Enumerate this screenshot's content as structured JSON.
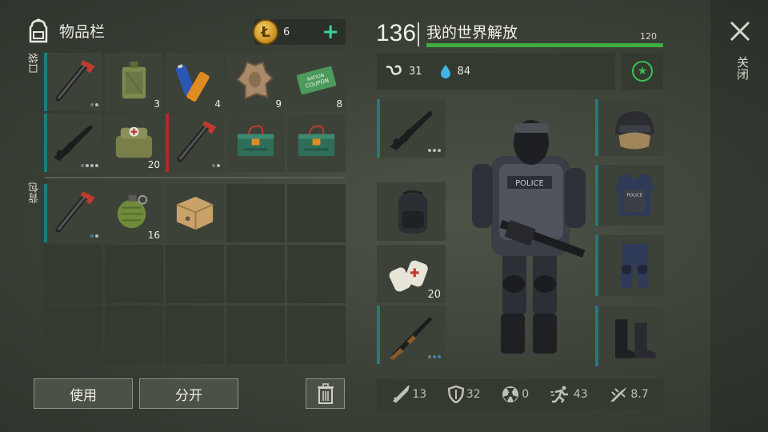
{
  "inventory": {
    "title": "物品栏",
    "coins": "6",
    "pockets_label": "口袋",
    "backpack_label": "背包",
    "pockets": [
      {
        "name": "crowbar",
        "dots": [
          "off",
          "on"
        ],
        "mark": "#1e7c7a"
      },
      {
        "name": "fuel-can",
        "qty": "3"
      },
      {
        "name": "batteries",
        "qty": "4"
      },
      {
        "name": "animal-hide",
        "qty": "9"
      },
      {
        "name": "ration-coupon",
        "qty": "8",
        "text": "RATION COUPON"
      },
      {
        "name": "rifle",
        "dots": [
          "off",
          "on",
          "on",
          "on"
        ],
        "mark": "#1e7c7a"
      },
      {
        "name": "medkit-bag",
        "qty": "20"
      },
      {
        "name": "crowbar",
        "dots": [
          "off",
          "on"
        ],
        "mark": "#b02a2a"
      },
      {
        "name": "green-case"
      },
      {
        "name": "green-case"
      }
    ],
    "backpack": [
      {
        "name": "crowbar",
        "dots": [
          "blue",
          "on"
        ],
        "mark": "#1e7c7a"
      },
      {
        "name": "grenade",
        "qty": "16"
      },
      {
        "name": "cardboard-box"
      }
    ],
    "use_button": "使用",
    "split_button": "分开"
  },
  "character": {
    "level": "136",
    "name": "我的世界解放",
    "xp_max": "120",
    "xp_fraction": 1.0,
    "hunger": "31",
    "thirst": "84",
    "close_label": "关闭",
    "weapon_slots": [
      {
        "name": "rifle",
        "dots": [
          "on",
          "on",
          "on"
        ]
      },
      {
        "name": "backpack"
      },
      {
        "name": "bandages",
        "qty": "20"
      },
      {
        "name": "shotgun",
        "dots": [
          "off",
          "blue",
          "blue"
        ]
      }
    ],
    "armor_slots": [
      "helmet",
      "vest",
      "pants",
      "boots"
    ],
    "stats": {
      "attack": "13",
      "defense": "32",
      "radiation": "0",
      "speed": "43",
      "stealth": "8.7"
    }
  },
  "colors": {
    "accent": "#3fd19a",
    "xp": "#3fae3a",
    "mark": "#1e7c7a",
    "broken": "#b02a2a"
  }
}
